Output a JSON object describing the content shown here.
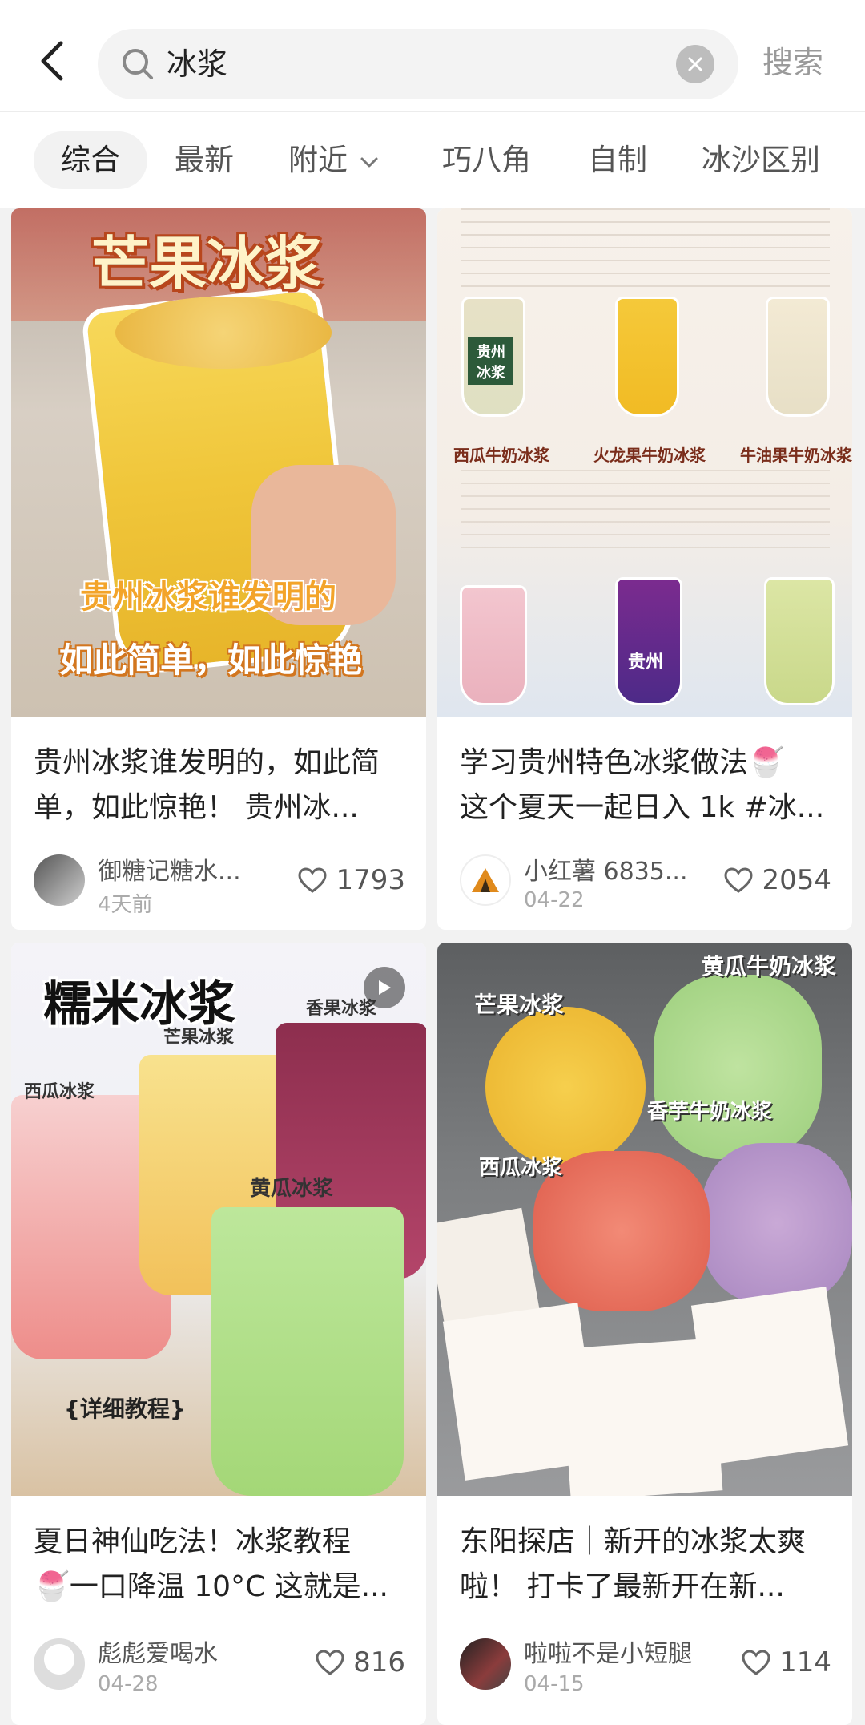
{
  "search": {
    "query": "冰浆",
    "submit_label": "搜索"
  },
  "tabs": [
    {
      "label": "综合"
    },
    {
      "label": "最新"
    },
    {
      "label": "附近"
    },
    {
      "label": "巧八角"
    },
    {
      "label": "自制"
    },
    {
      "label": "冰沙区别"
    }
  ],
  "cards": [
    {
      "title_line1": "贵州冰浆谁发明的，如此简",
      "title_line2": "单，如此惊艳！ 贵州冰...",
      "author": "御糖记糖水...",
      "date": "4天前",
      "likes": "1793",
      "overlay": {
        "headline": "芒果冰浆",
        "line1": "贵州冰浆谁发明的",
        "line2": "如此简单，如此惊艳"
      }
    },
    {
      "title_line1": "学习贵州特色冰浆做法🍧",
      "title_line2": "这个夏天一起日入 1k #冰...",
      "author": "小红薯 6835...",
      "date": "04-22",
      "likes": "2054",
      "overlay": {
        "recipes": [
          "西瓜牛奶冰浆",
          "火龙果牛奶冰浆",
          "牛油果牛奶冰浆"
        ],
        "cup_label": "贵州冰浆",
        "cup_label_short": "贵州"
      }
    },
    {
      "title_line1": "夏日神仙吃法！冰浆教程",
      "title_line2": "🍧一口降温 10°C 这就是...",
      "author": "彪彪爱喝水",
      "date": "04-28",
      "likes": "816",
      "overlay": {
        "headline": "糯米冰浆",
        "labels": [
          "西瓜冰浆",
          "芒果冰浆",
          "香果冰浆",
          "黄瓜冰浆"
        ],
        "footer": "{详细教程}"
      }
    },
    {
      "title_line1": "东阳探店｜新开的冰浆太爽",
      "title_line2": "啦！ 打卡了最新开在新...",
      "author": "啦啦不是小短腿",
      "date": "04-15",
      "likes": "114",
      "overlay": {
        "labels": [
          "芒果冰浆",
          "黄瓜牛奶冰浆",
          "香芋牛奶冰浆",
          "西瓜冰浆"
        ]
      }
    }
  ],
  "colors": {
    "accent_red": "#ff2442",
    "text": "#222222",
    "muted": "#aaaaaa"
  }
}
